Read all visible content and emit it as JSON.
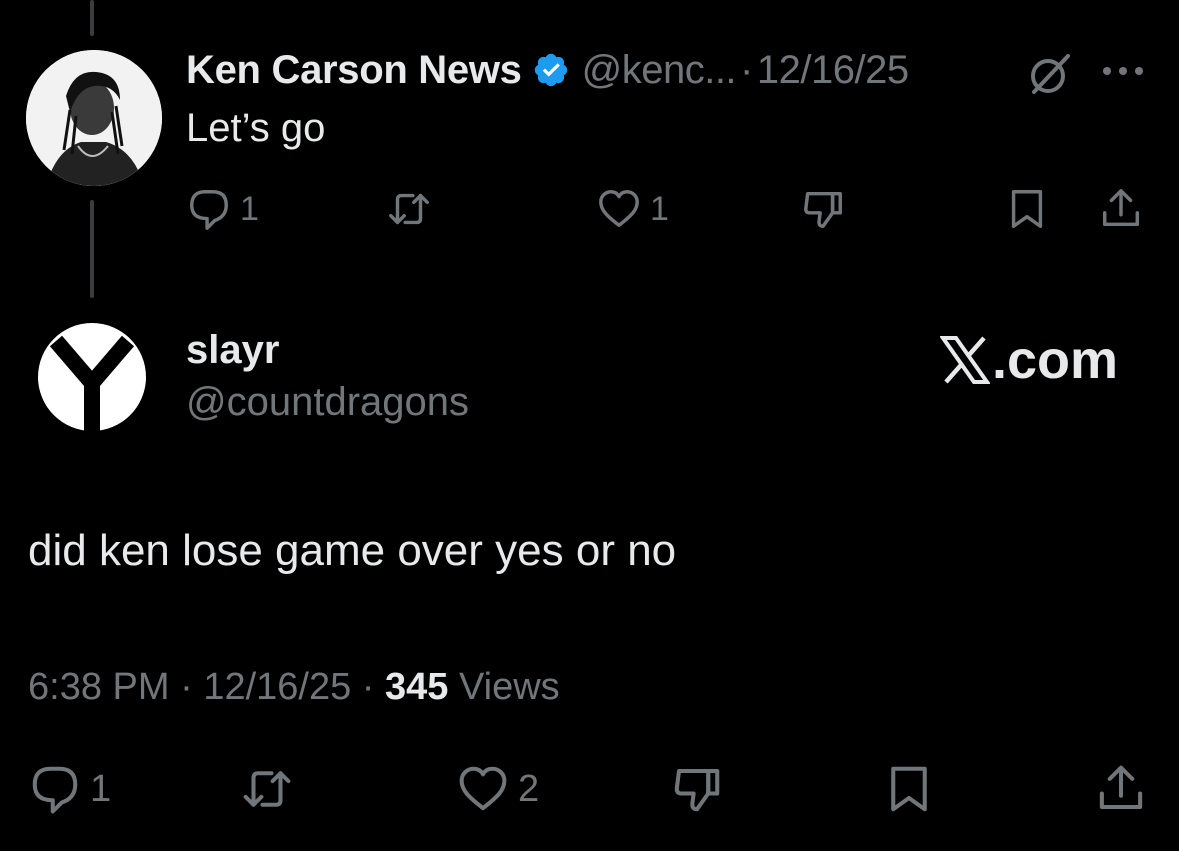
{
  "parent_tweet": {
    "author_name": "Ken Carson News",
    "handle": "@kenc...",
    "separator": "·",
    "date": "12/16/25",
    "text": "Let’s go",
    "actions": {
      "replies": "1",
      "likes": "1"
    },
    "icons": [
      "reply-icon",
      "retweet-icon",
      "like-icon",
      "dislike-icon",
      "bookmark-icon",
      "share-icon",
      "grok-icon",
      "more-icon",
      "verified-badge-icon"
    ],
    "verified_color": "#1d9bf0"
  },
  "reply_tweet": {
    "author_name": "slayr",
    "handle": "@countdragons",
    "site": ".com",
    "text": "did ken lose game over yes or no",
    "time": "6:38 PM",
    "separator": "·",
    "date": "12/16/25",
    "views_count": "345",
    "views_label": "Views",
    "actions": {
      "replies": "1",
      "likes": "2"
    }
  },
  "colors": {
    "background": "#000000",
    "primary_text": "#e7e9ea",
    "secondary_text": "#71767b",
    "thread_line": "#3a3d40"
  }
}
